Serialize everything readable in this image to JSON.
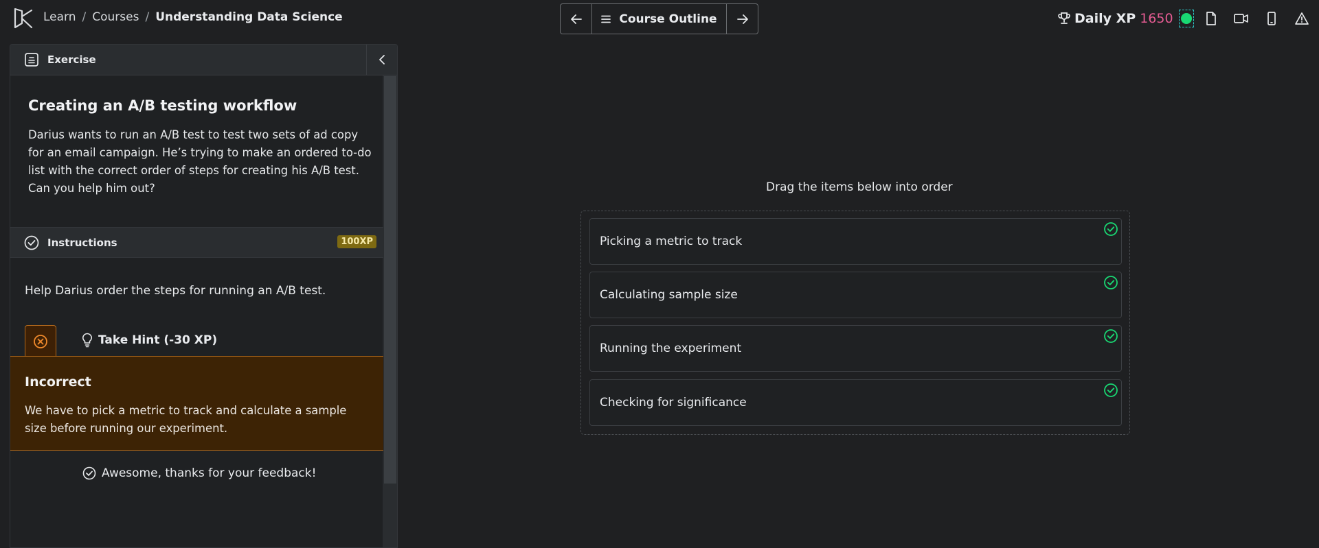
{
  "breadcrumb": {
    "items": [
      "Learn",
      "Courses"
    ],
    "current": "Understanding Data Science",
    "separator": "/"
  },
  "header": {
    "outline_label": "Course Outline",
    "xp_label": "Daily XP",
    "xp_value": "1650",
    "icons": [
      "trophy-icon",
      "file-icon",
      "video-icon",
      "mobile-icon",
      "warning-icon"
    ]
  },
  "colors": {
    "xp": "#e45b92",
    "success": "#19d873",
    "incorrect_bg": "#3d2305",
    "incorrect_border": "#a86418",
    "xp_badge": "#7e6a12"
  },
  "panel": {
    "header_label": "Exercise",
    "title": "Creating an A/B testing workflow",
    "description": "Darius wants to run an A/B test to test two sets of ad copy for an email campaign. He’s trying to make an ordered to-do list with the correct order of steps for creating his A/B test. Can you help him out?",
    "instructions_label": "Instructions",
    "xp_badge": "100XP",
    "instruction_text": "Help Darius order the steps for running an A/B test.",
    "hint_label": "Take Hint (-30 XP)",
    "feedback": {
      "title": "Incorrect",
      "text": "We have to pick a metric to track and calculate a sample size before running our experiment."
    },
    "thanks_text": "Awesome, thanks for your feedback!"
  },
  "exercise": {
    "instruction": "Drag the items below into order",
    "items": [
      {
        "label": "Picking a metric to track",
        "correct": true
      },
      {
        "label": "Calculating sample size",
        "correct": true
      },
      {
        "label": "Running the experiment",
        "correct": true
      },
      {
        "label": "Checking for significance",
        "correct": true
      }
    ]
  }
}
